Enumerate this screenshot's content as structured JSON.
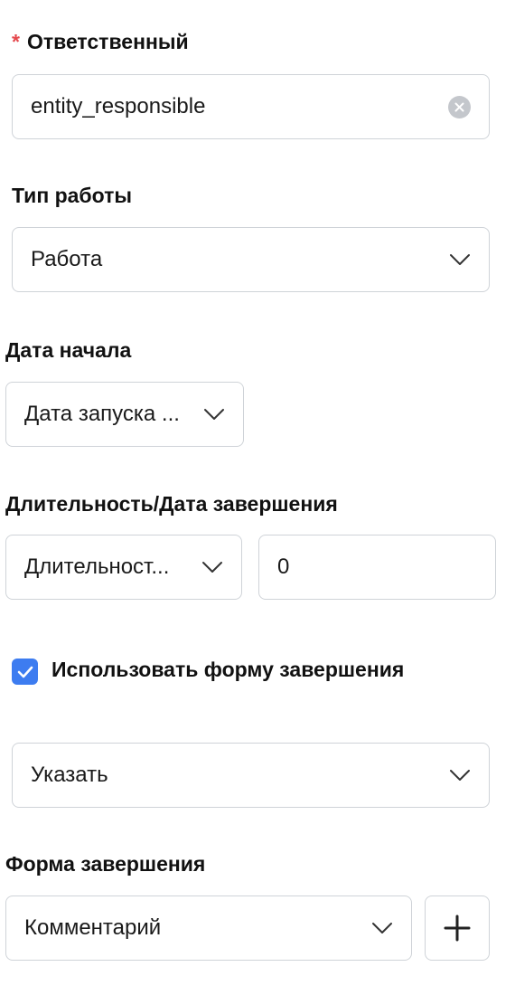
{
  "responsible": {
    "required_mark": "*",
    "label": "Ответственный",
    "value": "entity_responsible"
  },
  "work_type": {
    "label": "Тип работы",
    "value": "Работа"
  },
  "start_date": {
    "label": "Дата начала",
    "value": "Дата запуска ..."
  },
  "duration": {
    "label": "Длительность/Дата завершения",
    "mode_value": "Длительност...",
    "amount_value": "0"
  },
  "completion_form_toggle": {
    "label": "Использовать форму завершения",
    "checked": true,
    "value": "Указать"
  },
  "completion_form": {
    "label": "Форма завершения",
    "value": "Комментарий"
  },
  "icons": {
    "clear": "clear-icon",
    "chevron": "chevron-down-icon",
    "check": "checkmark-icon",
    "plus": "plus-icon"
  },
  "colors": {
    "accent": "#3d7cf0",
    "required": "#e5484d",
    "border": "#cfd3d8"
  }
}
